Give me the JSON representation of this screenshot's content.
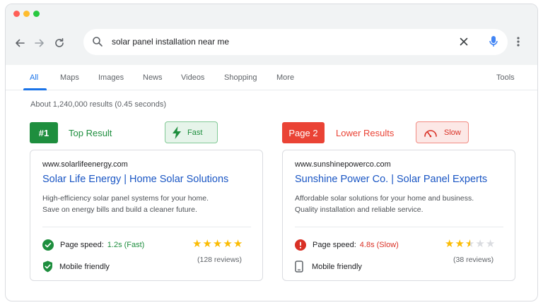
{
  "browser": {
    "search_query": "solar panel installation near me"
  },
  "tabs": [
    {
      "label": "All",
      "active": true
    },
    {
      "label": "Maps"
    },
    {
      "label": "Images"
    },
    {
      "label": "News"
    },
    {
      "label": "Videos"
    },
    {
      "label": "Shopping"
    },
    {
      "label": "More"
    },
    {
      "label": "Tools"
    }
  ],
  "result_stats": "About 1,240,000 results (0.45 seconds)",
  "left": {
    "rank_badge": "#1",
    "rank_label": "Top Result",
    "speed_pill": "Fast",
    "url": "www.solarlifeenergy.com",
    "title": "Solar Life Energy  | Home Solar Solutions",
    "desc_line1": "High-efficiency solar panel systems for your home.",
    "desc_line2": "Save on energy bills and build a cleaner future.",
    "speed_label": "Page speed:",
    "speed_value": "1.2s (Fast)",
    "mobile_label": "Mobile friendly",
    "rating": 5,
    "reviews": "(128 reviews)"
  },
  "right": {
    "rank_badge": "Page 2",
    "rank_label": "Lower Results",
    "speed_pill": "Slow",
    "url": "www.sunshinepowerco.com",
    "title": "Sunshine Power Co. | Solar Panel Experts",
    "desc_line1": "Affordable solar solutions for your home and business.",
    "desc_line2": "Quality installation and reliable service.",
    "speed_label": "Page speed:",
    "speed_value": "4.8s (Slow)",
    "mobile_label": "Mobile friendly",
    "rating": 2.5,
    "reviews": "(38 reviews)"
  },
  "colors": {
    "accent_blue": "#1a73e8",
    "good_green": "#1e8e3e",
    "bad_red": "#ea4335",
    "star": "#fbbc04"
  }
}
